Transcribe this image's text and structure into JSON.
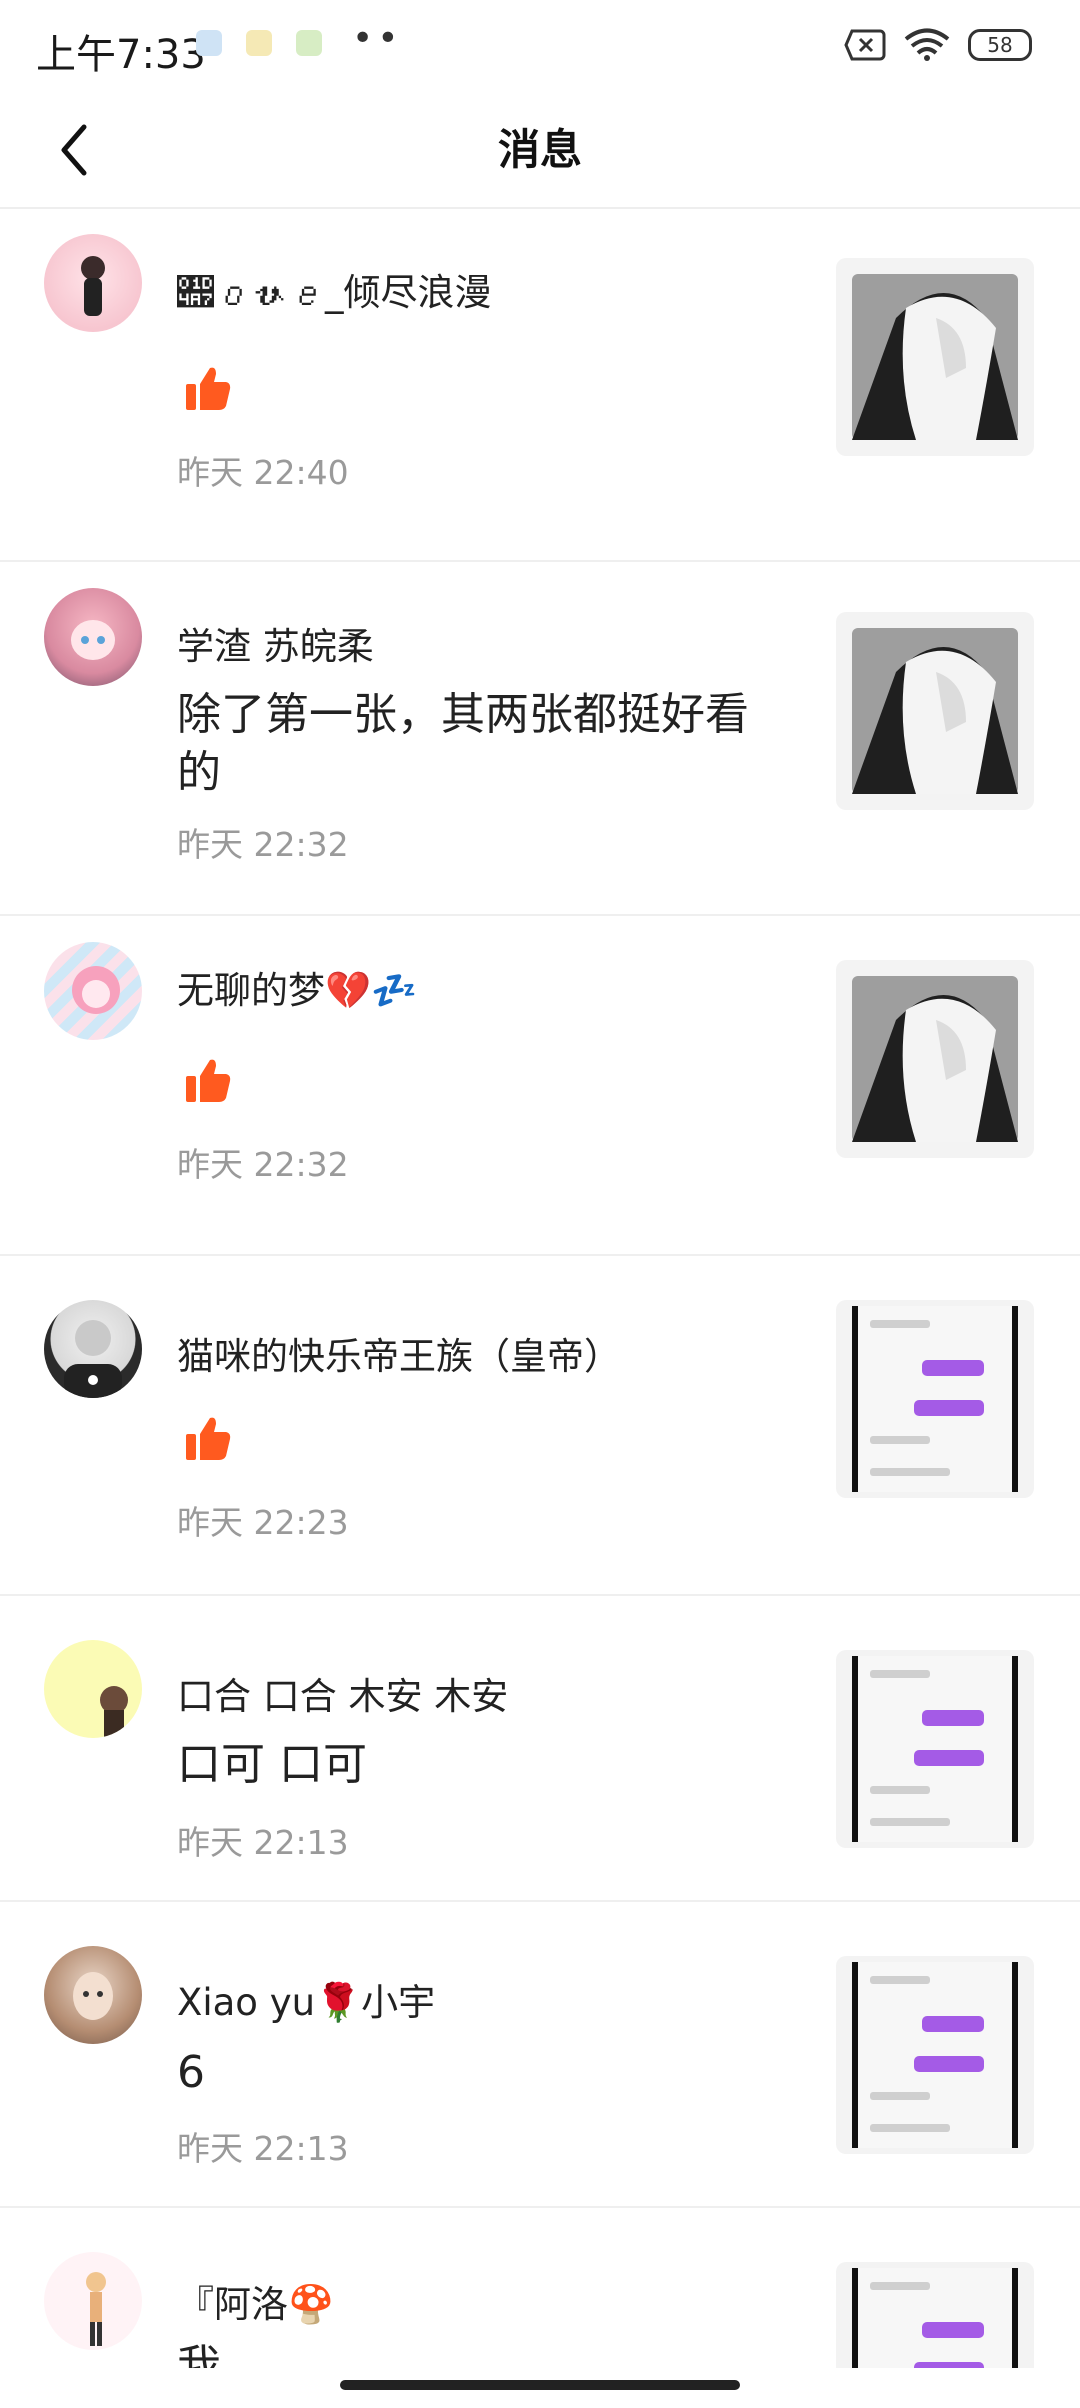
{
  "status_bar": {
    "time": "上午7:33",
    "battery": "58"
  },
  "header": {
    "title": "消息"
  },
  "messages": [
    {
      "name": "𝒧𝑜𝓋𝑒_倾尽浪漫",
      "content": "",
      "like": true,
      "time": "昨天 22:40",
      "thumb": "girl-art"
    },
    {
      "name": "学渣  苏皖柔",
      "content": "除了第一张，其两张都挺好看的",
      "like": false,
      "time": "昨天 22:32",
      "thumb": "girl-art"
    },
    {
      "name": "无聊的梦💔💤",
      "content": "",
      "like": true,
      "time": "昨天 22:32",
      "thumb": "girl-art"
    },
    {
      "name": "猫咪的快乐帝王族（皇帝）",
      "content": "",
      "like": true,
      "time": "昨天 22:23",
      "thumb": "chat-screenshot"
    },
    {
      "name": "口合  口合 木安 木安",
      "content": "口可 口可",
      "like": false,
      "time": "昨天 22:13",
      "thumb": "chat-screenshot"
    },
    {
      "name": "Xiao yu🌹小宇",
      "content": "6",
      "like": false,
      "time": "昨天 22:13",
      "thumb": "chat-screenshot"
    },
    {
      "name": "『阿洛🍄",
      "content": "我",
      "like": false,
      "time": "",
      "thumb": "chat-screenshot"
    }
  ],
  "colors": {
    "like": "#ff5a1f",
    "time": "#9a9a9a",
    "name": "#222222"
  }
}
